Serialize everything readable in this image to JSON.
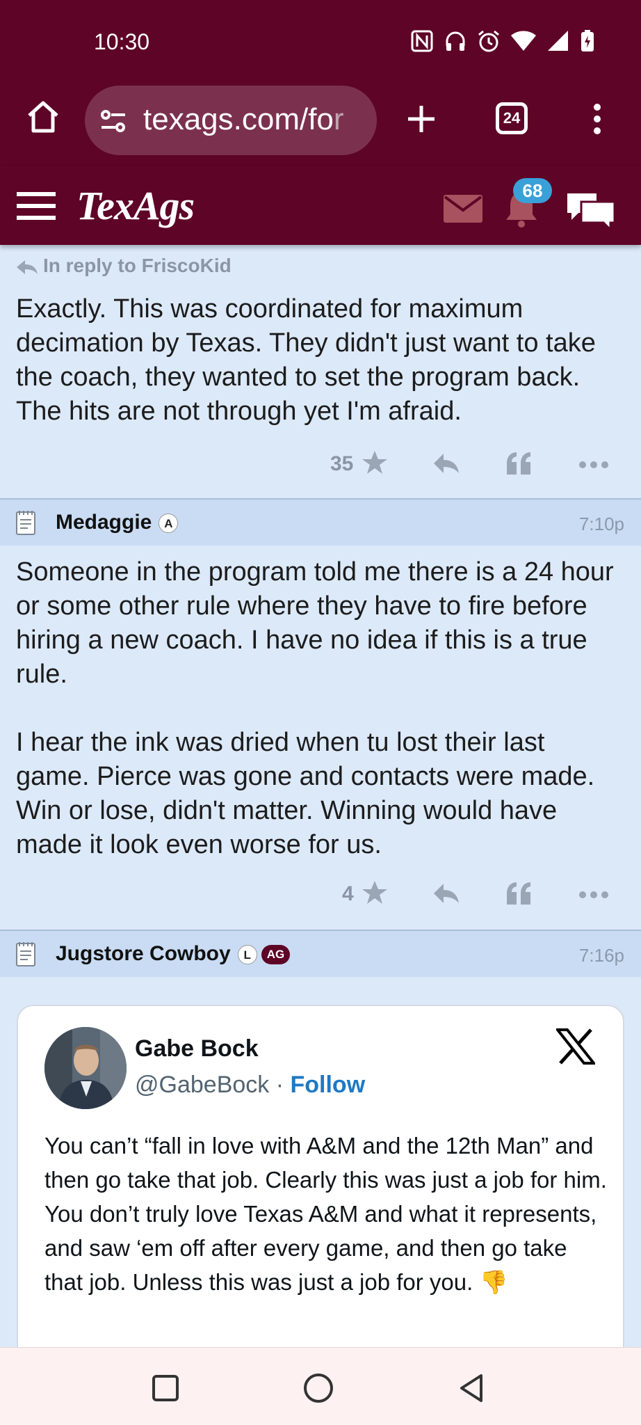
{
  "status_bar": {
    "time": "10:30",
    "icons": [
      "nfc-icon",
      "headphones-icon",
      "alarm-icon",
      "wifi-icon",
      "signal-icon",
      "battery-charging-icon"
    ]
  },
  "browser": {
    "url_visible": "texags.com/fo",
    "url_faded": "r",
    "tab_count": "24"
  },
  "site": {
    "logo": "TexAgs",
    "notification_count": "68"
  },
  "posts": [
    {
      "reply_to": "In reply to FriscoKid",
      "body": "Exactly. This was coordinated for maximum decimation by Texas. They didn't just want to take the coach, they wanted to set the program back. The hits are not through yet I'm afraid.",
      "stars": "35"
    },
    {
      "author": "Medaggie",
      "rank": "A",
      "time": "7:10p",
      "body_p1": "Someone in the program told me there is a 24 hour or some other rule where they have to fire before hiring a new coach. I have no idea if this is a true rule.",
      "body_p2": "I hear the ink was dried when tu lost their last game. Pierce was gone and contacts were made. Win or lose, didn't matter. Winning would have made it look even worse for us.",
      "stars": "4"
    },
    {
      "author": "Jugstore Cowboy",
      "rank": "L",
      "rank2": "AG",
      "time": "7:16p",
      "tweet": {
        "name": "Gabe Bock",
        "handle": "@GabeBock",
        "separator": " · ",
        "follow": "Follow",
        "text": "You can’t “fall in love with A&M and the 12th Man” and then go take that job. Clearly this was just a job for him. You don’t truly love Texas A&M and what it represents, and saw ‘em off after every game, and then go take that job. Unless this was just a job for you. 👎"
      }
    }
  ]
}
